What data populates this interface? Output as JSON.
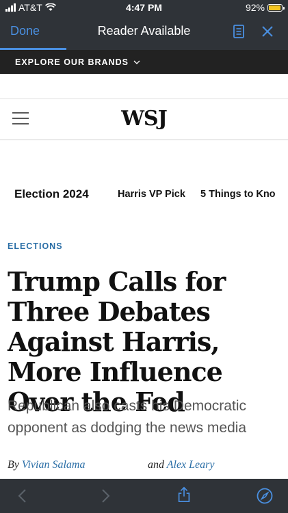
{
  "status_bar": {
    "carrier": "AT&T",
    "time": "4:47 PM",
    "battery": "92%",
    "battery_level": 0.92
  },
  "browser": {
    "done_label": "Done",
    "title": "Reader Available",
    "reading_progress": 0.23,
    "icons": [
      "reader-view-icon",
      "close-icon"
    ]
  },
  "explore": {
    "label": "EXPLORE OUR BRANDS"
  },
  "header": {
    "logo": "WSJ"
  },
  "topics": [
    "Election 2024",
    "Harris VP Pick",
    "5 Things to Kno"
  ],
  "article": {
    "section": "ELECTIONS",
    "headline": "Trump Calls for Three Debates Against Harris, More Influence Over the Fed",
    "dek": "Republican also casts his Democratic opponent as dodging the news media",
    "byline": {
      "by": "By",
      "author1": "Vivian Salama",
      "and": "and",
      "author2": "Alex Leary"
    }
  },
  "toolbar": {
    "icons": [
      "back-icon",
      "forward-icon",
      "share-icon",
      "compass-icon"
    ]
  },
  "colors": {
    "chrome": "#2f3338",
    "accent": "#4a90e2",
    "link": "#2a6ea6",
    "battery": "#f4c622"
  }
}
